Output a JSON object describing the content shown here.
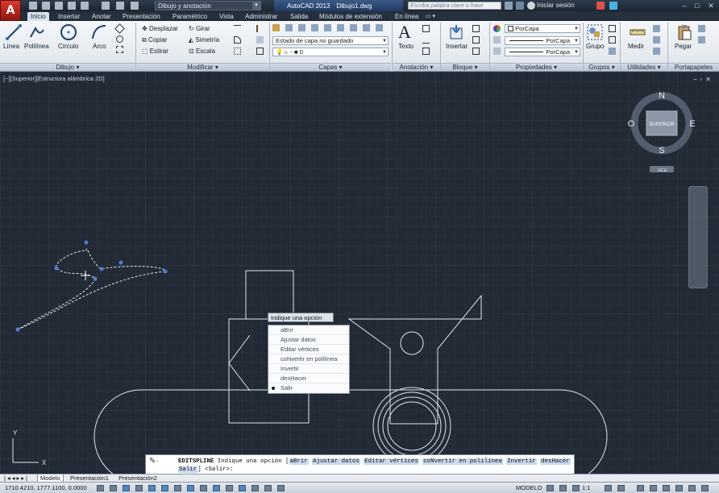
{
  "titlebar": {
    "workspace": "Dibujo y anotación",
    "app_name": "AutoCAD 2013",
    "document": "Dibujo1.dwg",
    "search_placeholder": "Escriba palabra clave o frase",
    "login": "Iniciar sesión"
  },
  "tabs": [
    "Inicio",
    "Insertar",
    "Anotar",
    "Presentación",
    "Paramétrico",
    "Vista",
    "Administrar",
    "Salida",
    "Módulos de extensión",
    "En línea"
  ],
  "ribbon": {
    "draw": {
      "title": "Dibujo",
      "linea": "Línea",
      "polilinea": "Polilínea",
      "circulo": "Círculo",
      "arco": "Arco"
    },
    "modify": {
      "title": "Modificar",
      "desplazar": "Desplazar",
      "girar": "Girar",
      "copiar": "Copiar",
      "simetria": "Simetría",
      "estirar": "Estirar",
      "escala": "Escala"
    },
    "layers": {
      "title": "Capas",
      "state": "Estado de capa no guardado",
      "current": "0"
    },
    "annotation": {
      "title": "Anotación",
      "texto": "Texto"
    },
    "block": {
      "title": "Bloque",
      "insertar": "Insertar"
    },
    "properties": {
      "title": "Propiedades",
      "color": "PorCapa",
      "linetype": "PorCapa",
      "lineweight": "PorCapa"
    },
    "groups": {
      "title": "Grupos",
      "grupo": "Grupo"
    },
    "utilities": {
      "title": "Utilidades",
      "medir": "Medir"
    },
    "clipboard": {
      "title": "Portapapeles",
      "pegar": "Pegar"
    }
  },
  "viewport": {
    "label": "[−][Superior][Estructura alámbrica 2D]",
    "viewcube": {
      "n": "N",
      "s": "S",
      "e": "E",
      "w": "O",
      "face": "SUPERIOR",
      "ucs": "SCU"
    }
  },
  "context_menu": {
    "title": "Indique una opción",
    "items": [
      "aBrir",
      "Ajustar datos",
      "Editar vértices",
      "coNvertir en polilínea",
      "Invertir",
      "desHacer",
      "Salir"
    ],
    "selected": "Salir"
  },
  "command_line": {
    "command": "EDITSPLINE",
    "prompt": "Indique una opción [",
    "options": [
      "aBrir",
      "Ajustar datos",
      "Editar vértices",
      "coNvertir en polilínea",
      "Invertir",
      "desHacer",
      "Salir"
    ],
    "suffix": "] <Salir>:"
  },
  "layout_tabs": [
    "Modelo",
    "Presentación1",
    "Presentación2"
  ],
  "status": {
    "coords": "1710.4210, 1777.1100, 0.0000",
    "mode": "MODELO",
    "scale": "1:1"
  }
}
